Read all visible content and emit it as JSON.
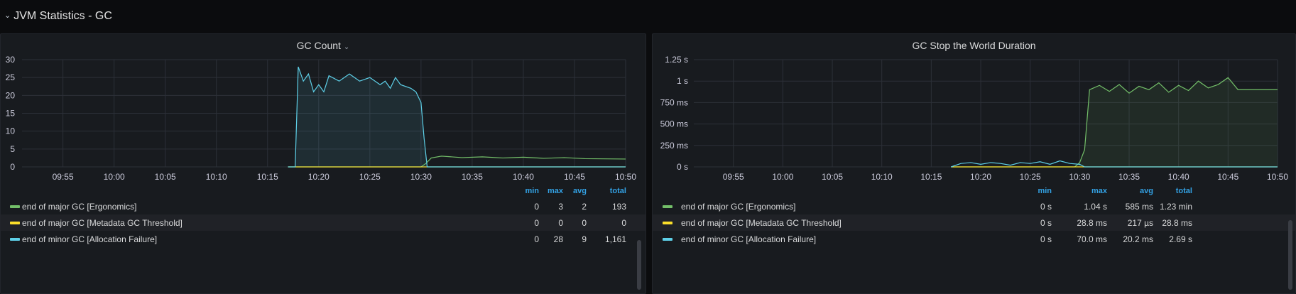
{
  "row": {
    "title": "JVM Statistics - GC",
    "collapse_icon": "chevron-down-icon"
  },
  "panels": [
    {
      "title": "GC Count",
      "has_menu_chevron": true,
      "legend_headers": {
        "min": "min",
        "max": "max",
        "avg": "avg",
        "total": "total"
      },
      "legend": [
        {
          "name": "end of major GC [Ergonomics]",
          "color": "#73bf69",
          "min": "0",
          "max": "3",
          "avg": "2",
          "total": "193"
        },
        {
          "name": "end of major GC [Metadata GC Threshold]",
          "color": "#fade2a",
          "min": "0",
          "max": "0",
          "avg": "0",
          "total": "0"
        },
        {
          "name": "end of minor GC [Allocation Failure]",
          "color": "#5ed0e8",
          "min": "0",
          "max": "28",
          "avg": "9",
          "total": "1,161"
        }
      ]
    },
    {
      "title": "GC Stop the World Duration",
      "has_menu_chevron": false,
      "legend_headers": {
        "min": "min",
        "max": "max",
        "avg": "avg",
        "total": "total"
      },
      "legend": [
        {
          "name": "end of major GC [Ergonomics]",
          "color": "#73bf69",
          "min": "0 s",
          "max": "1.04 s",
          "avg": "585 ms",
          "total": "1.23 min"
        },
        {
          "name": "end of major GC [Metadata GC Threshold]",
          "color": "#fade2a",
          "min": "0 s",
          "max": "28.8 ms",
          "avg": "217 µs",
          "total": "28.8 ms"
        },
        {
          "name": "end of minor GC [Allocation Failure]",
          "color": "#5ed0e8",
          "min": "0 s",
          "max": "70.0 ms",
          "avg": "20.2 ms",
          "total": "2.69 s"
        }
      ]
    }
  ],
  "chart_data": [
    {
      "type": "line",
      "title": "GC Count",
      "x_ticks": [
        "09:55",
        "10:00",
        "10:05",
        "10:10",
        "10:15",
        "10:20",
        "10:25",
        "10:30",
        "10:35",
        "10:40",
        "10:45",
        "10:50"
      ],
      "xlim": [
        "09:51",
        "10:50"
      ],
      "y_ticks": [
        "0",
        "5",
        "10",
        "15",
        "20",
        "25",
        "30"
      ],
      "ylim": [
        0,
        30
      ],
      "grid": true,
      "legend_placement": "bottom",
      "series": [
        {
          "name": "end of major GC [Ergonomics]",
          "color": "#73bf69",
          "fill": false,
          "points": [
            [
              "10:17",
              0
            ],
            [
              "10:30",
              0
            ],
            [
              "10:30.5",
              1
            ],
            [
              "10:31",
              2.5
            ],
            [
              "10:32",
              3
            ],
            [
              "10:34",
              2.6
            ],
            [
              "10:36",
              2.8
            ],
            [
              "10:38",
              2.5
            ],
            [
              "10:40",
              2.7
            ],
            [
              "10:42",
              2.4
            ],
            [
              "10:44",
              2.6
            ],
            [
              "10:46",
              2.3
            ],
            [
              "10:50",
              2.2
            ]
          ]
        },
        {
          "name": "end of major GC [Metadata GC Threshold]",
          "color": "#fade2a",
          "fill": false,
          "points": [
            [
              "10:17",
              0
            ],
            [
              "10:50",
              0
            ]
          ]
        },
        {
          "name": "end of minor GC [Allocation Failure]",
          "color": "#5ed0e8",
          "fill": true,
          "points": [
            [
              "10:17",
              0
            ],
            [
              "10:17.7",
              0
            ],
            [
              "10:18",
              28
            ],
            [
              "10:18.5",
              24
            ],
            [
              "10:19",
              26
            ],
            [
              "10:19.5",
              21
            ],
            [
              "10:20",
              23
            ],
            [
              "10:20.5",
              21
            ],
            [
              "10:21",
              25.5
            ],
            [
              "10:22",
              24
            ],
            [
              "10:23",
              26
            ],
            [
              "10:24",
              24
            ],
            [
              "10:25",
              25
            ],
            [
              "10:26",
              23
            ],
            [
              "10:26.5",
              24
            ],
            [
              "10:27",
              22
            ],
            [
              "10:27.5",
              25
            ],
            [
              "10:28",
              23
            ],
            [
              "10:29",
              22
            ],
            [
              "10:29.5",
              21
            ],
            [
              "10:30",
              18
            ],
            [
              "10:30.3",
              8
            ],
            [
              "10:30.6",
              0
            ],
            [
              "10:50",
              0
            ]
          ]
        }
      ]
    },
    {
      "type": "line",
      "title": "GC Stop the World Duration",
      "x_ticks": [
        "09:55",
        "10:00",
        "10:05",
        "10:10",
        "10:15",
        "10:20",
        "10:25",
        "10:30",
        "10:35",
        "10:40",
        "10:45",
        "10:50"
      ],
      "xlim": [
        "09:51",
        "10:50"
      ],
      "y_ticks": [
        "0 s",
        "250 ms",
        "500 ms",
        "750 ms",
        "1 s",
        "1.25 s"
      ],
      "ylim": [
        0,
        1.25
      ],
      "y_unit": "s",
      "grid": true,
      "legend_placement": "bottom",
      "series": [
        {
          "name": "end of major GC [Ergonomics]",
          "color": "#73bf69",
          "fill": true,
          "points": [
            [
              "10:17",
              0
            ],
            [
              "10:29.5",
              0
            ],
            [
              "10:30",
              0.05
            ],
            [
              "10:30.5",
              0.2
            ],
            [
              "10:31",
              0.9
            ],
            [
              "10:32",
              0.95
            ],
            [
              "10:33",
              0.88
            ],
            [
              "10:34",
              0.96
            ],
            [
              "10:35",
              0.86
            ],
            [
              "10:36",
              0.94
            ],
            [
              "10:37",
              0.9
            ],
            [
              "10:38",
              0.98
            ],
            [
              "10:39",
              0.87
            ],
            [
              "10:40",
              0.95
            ],
            [
              "10:41",
              0.89
            ],
            [
              "10:42",
              1.0
            ],
            [
              "10:43",
              0.92
            ],
            [
              "10:44",
              0.96
            ],
            [
              "10:45",
              1.04
            ],
            [
              "10:46",
              0.9
            ],
            [
              "10:50",
              0.9
            ]
          ]
        },
        {
          "name": "end of major GC [Metadata GC Threshold]",
          "color": "#fade2a",
          "fill": false,
          "points": [
            [
              "10:17",
              0
            ],
            [
              "10:50",
              0
            ]
          ]
        },
        {
          "name": "end of minor GC [Allocation Failure]",
          "color": "#5ed0e8",
          "fill": false,
          "points": [
            [
              "10:17",
              0
            ],
            [
              "10:18",
              0.04
            ],
            [
              "10:19",
              0.05
            ],
            [
              "10:20",
              0.03
            ],
            [
              "10:21",
              0.05
            ],
            [
              "10:22",
              0.04
            ],
            [
              "10:23",
              0.02
            ],
            [
              "10:24",
              0.05
            ],
            [
              "10:25",
              0.04
            ],
            [
              "10:26",
              0.06
            ],
            [
              "10:27",
              0.03
            ],
            [
              "10:28",
              0.07
            ],
            [
              "10:29",
              0.04
            ],
            [
              "10:30",
              0.03
            ],
            [
              "10:30.5",
              0
            ],
            [
              "10:50",
              0
            ]
          ]
        }
      ]
    }
  ]
}
